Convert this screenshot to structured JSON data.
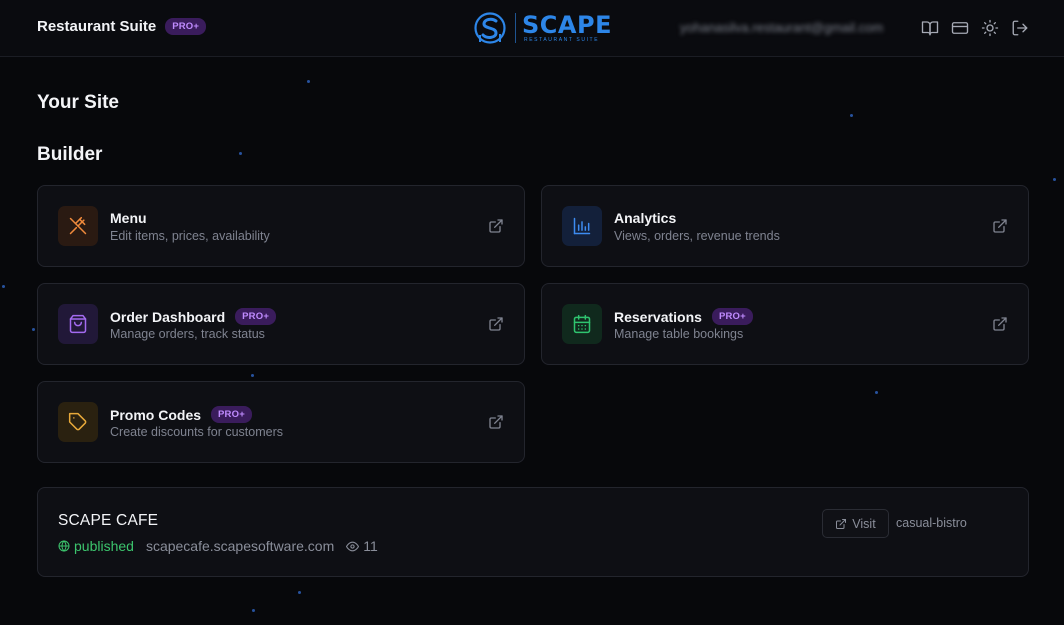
{
  "header": {
    "brand_title": "Restaurant Suite",
    "plan_badge": "PRO+",
    "logo_name": "SCAPE",
    "logo_sub": "RESTAURANT SUITE",
    "user_email": "yohanasilva.restaurant@gmail.com",
    "icons": [
      "book-icon",
      "card-icon",
      "sun-icon",
      "logout-icon"
    ]
  },
  "page": {
    "title": "Your Site",
    "section_title": "Builder"
  },
  "builder_cards": [
    {
      "title": "Menu",
      "subtitle": "Edit items, prices, availability",
      "badge": "",
      "icon": "utensils-icon",
      "accent": "#f08a3c",
      "icon_bg": "#2a1a12"
    },
    {
      "title": "Analytics",
      "subtitle": "Views, orders, revenue trends",
      "badge": "",
      "icon": "bar-chart-icon",
      "accent": "#3d8bf0",
      "icon_bg": "#13203a"
    },
    {
      "title": "Order Dashboard",
      "subtitle": "Manage orders, track status",
      "badge": "PRO+",
      "icon": "shopping-bag-icon",
      "accent": "#a36bf0",
      "icon_bg": "#211838"
    },
    {
      "title": "Reservations",
      "subtitle": "Manage table bookings",
      "badge": "PRO+",
      "icon": "calendar-icon",
      "accent": "#2fc46f",
      "icon_bg": "#10291d"
    },
    {
      "title": "Promo Codes",
      "subtitle": "Create discounts for customers",
      "badge": "PRO+",
      "icon": "tag-icon",
      "accent": "#e8a93a",
      "icon_bg": "#2a2110"
    }
  ],
  "site": {
    "name": "SCAPE CAFE",
    "status": "published",
    "url": "scapecafe.scapesoftware.com",
    "views": "11",
    "visit_label": "Visit",
    "template": "casual-bistro"
  },
  "colors": {
    "background": "#07080b",
    "card": "#0e0f14",
    "border": "#23252d",
    "pro_badge_bg": "#3a1c5c",
    "pro_badge_text": "#c08bff",
    "published": "#3cc46d",
    "logo": "#2d86e8"
  }
}
